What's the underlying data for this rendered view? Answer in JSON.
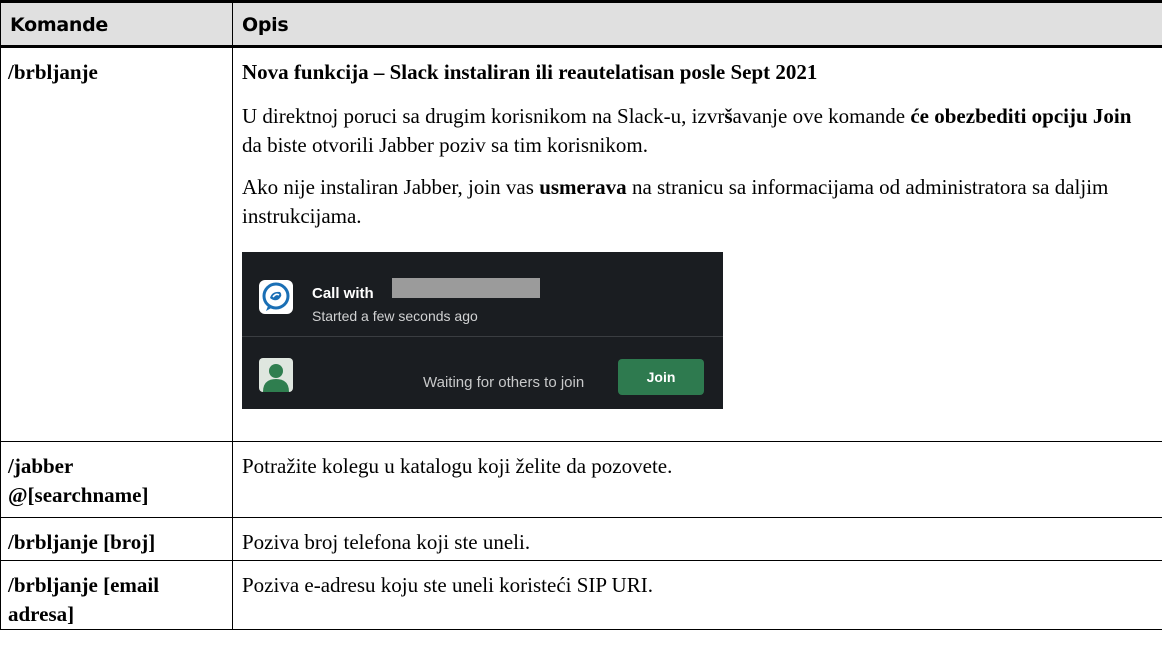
{
  "header": {
    "col_command": "Komande",
    "col_description": "Opis"
  },
  "rows": [
    {
      "command": "/brbljanje",
      "title": "Nova funkcija – Slack instaliran ili reautelatisan  posle Sept 2021",
      "p1": {
        "t1": "U direktnoj poruci sa drugim korisnikom na Slack-u, izvr",
        "t2": "š",
        "t3": "avanje ove komande ",
        "t4": "će obezbediti opciju Join",
        "t5": " da biste otvorili Jabber poziv sa tim korisnikom."
      },
      "p2": {
        "t1": "Ako nije instaliran Jabber, join vas  ",
        "t2": "usmerava",
        "t3": " na stranicu sa informacijama od administratora sa daljim instrukcijama."
      },
      "slack": {
        "call_title": "Call with",
        "call_subtitle": "Started a few seconds ago",
        "waiting_text": "Waiting for others to join",
        "join_label": "Join"
      }
    },
    {
      "command_line1": "/jabber",
      "command_line2": "@[searchname]",
      "description": "Potražite kolegu u katalogu koji želite da pozovete."
    },
    {
      "command": "/brbljanje [broj]",
      "description": "Poziva broj telefona koji ste uneli."
    },
    {
      "command_line1": "/brbljanje [email",
      "command_line2": "adresa]",
      "description": "Poziva e-adresu koju ste uneli koristeći SIP URI."
    }
  ]
}
